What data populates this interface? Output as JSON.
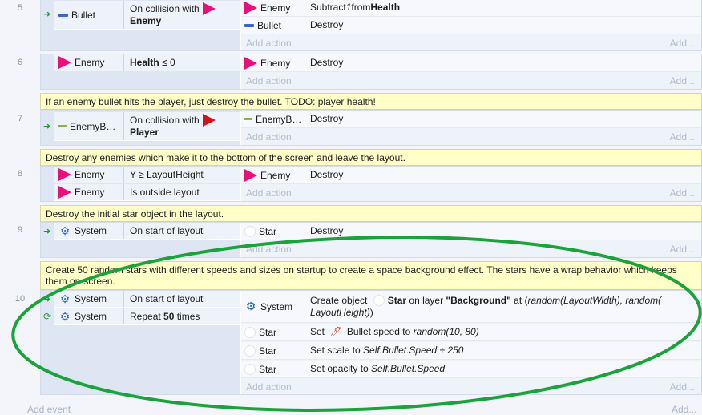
{
  "events": [
    {
      "number": "5",
      "conditions": [
        {
          "object": "Bullet",
          "text": "On collision with",
          "target": "Enemy"
        }
      ],
      "actions": [
        {
          "object": "Enemy",
          "text_pre": "Subtract ",
          "text_em": "1",
          "text_mid": " from ",
          "text_b": "Health"
        },
        {
          "object": "Bullet",
          "text": "Destroy"
        }
      ]
    },
    {
      "number": "6",
      "conditions": [
        {
          "object": "Enemy",
          "text_b": "Health",
          "text": " ≤ 0"
        }
      ],
      "actions": [
        {
          "object": "Enemy",
          "text": "Destroy"
        }
      ]
    },
    {
      "number": "7",
      "comment": "If an enemy bullet hits the player, just destroy the bullet.  TODO: player health!",
      "conditions": [
        {
          "object": "EnemyB…",
          "text": "On collision with",
          "target": "Player"
        }
      ],
      "actions": [
        {
          "object": "EnemyB…",
          "text": "Destroy"
        }
      ]
    },
    {
      "number": "8",
      "comment": "Destroy any enemies which make it to the bottom of the screen and leave the layout.",
      "conditions": [
        {
          "object": "Enemy",
          "text": "Y ≥ LayoutHeight"
        },
        {
          "object": "Enemy",
          "text": "Is outside layout"
        }
      ],
      "actions": [
        {
          "object": "Enemy",
          "text": "Destroy"
        }
      ]
    },
    {
      "number": "9",
      "comment": "Destroy the initial star object in the layout.",
      "conditions": [
        {
          "object": "System",
          "text": "On start of layout"
        }
      ],
      "actions": [
        {
          "object": "Star",
          "text": "Destroy"
        }
      ]
    },
    {
      "number": "10",
      "comment": "Create 50 random stars with different speeds and sizes on startup to create a space background effect.  The stars have a wrap behavior which keeps them on-screen.",
      "conditions": [
        {
          "object": "System",
          "text": "On start of layout"
        },
        {
          "object": "System",
          "text_pre": "Repeat ",
          "text_b": "50",
          "text": " times"
        }
      ],
      "actions": [
        {
          "object": "System",
          "line1_pre": "Create object ",
          "line1_obj": "Star",
          "line1_mid": " on layer ",
          "line1_layer": "\"Background\"",
          "line1_at": " at (",
          "line1_expr": "random(LayoutWidth), random(",
          "line2_expr": "LayoutHeight)",
          "line2_end": ")"
        },
        {
          "object": "Star",
          "text_pre": "Set ",
          "text_mid": " Bullet speed to ",
          "text_em": "random(10, 80)"
        },
        {
          "object": "Star",
          "text_pre": "Set scale to ",
          "text_em": "Self.Bullet.Speed ÷ 250"
        },
        {
          "object": "Star",
          "text_pre": "Set opacity to ",
          "text_em": "Self.Bullet.Speed"
        }
      ]
    }
  ],
  "labels": {
    "add_action": "Add action",
    "add_ellipsis": "Add...",
    "add_event": "Add event"
  },
  "colors": {
    "comment_bg": "#ffffc8",
    "annotation_ellipse": "#1aa33a",
    "enemy": "#e8107a",
    "player": "#d4121e"
  }
}
